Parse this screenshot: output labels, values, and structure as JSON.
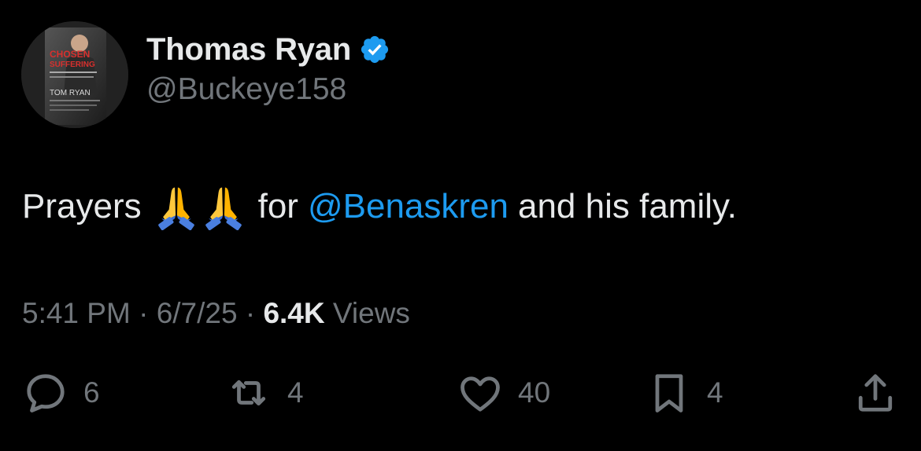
{
  "author": {
    "display_name": "Thomas Ryan",
    "handle": "@Buckeye158",
    "verified": true,
    "avatar": {
      "description_icon": "book-cover-avatar",
      "cover_title_line1": "CHOSEN",
      "cover_title_line2": "SUFFERING",
      "cover_author": "TOM RYAN"
    }
  },
  "tweet": {
    "text_before": "Prayers",
    "emoji": [
      "folded-hands-icon",
      "folded-hands-icon"
    ],
    "text_for": "for",
    "mention": "@Benaskren",
    "text_after": "and his family."
  },
  "meta": {
    "time": "5:41 PM",
    "separator": "·",
    "date": "6/7/25",
    "views_count": "6.4K",
    "views_label": "Views"
  },
  "actions": {
    "replies": "6",
    "reposts": "4",
    "likes": "40",
    "bookmarks": "4"
  },
  "colors": {
    "background": "#000000",
    "text": "#e7e9ea",
    "muted": "#71767b",
    "accent": "#1d9bf0"
  }
}
